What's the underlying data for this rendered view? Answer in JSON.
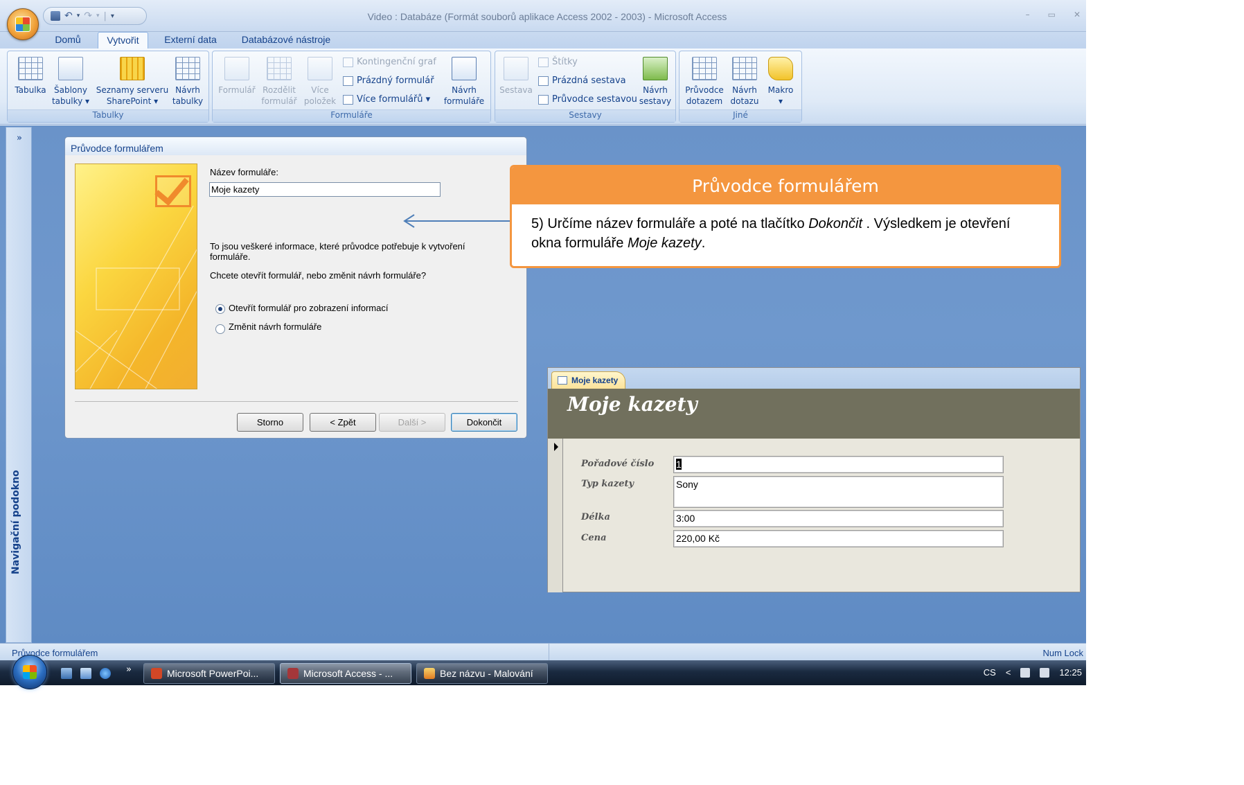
{
  "window": {
    "title": "Video : Databáze (Formát souborů aplikace Access 2002 - 2003) - Microsoft Access",
    "controls": [
      "–",
      "▭",
      "✕"
    ]
  },
  "qat": {
    "separator": "|",
    "dropdown": "▾"
  },
  "tabs": [
    {
      "label": "Domů",
      "active": false
    },
    {
      "label": "Vytvořit",
      "active": true
    },
    {
      "label": "Externí data",
      "active": false
    },
    {
      "label": "Databázové nástroje",
      "active": false
    }
  ],
  "ribbon": {
    "tabulky": {
      "label": "Tabulky",
      "buttons": [
        {
          "line1": "Tabulka",
          "line2": ""
        },
        {
          "line1": "Šablony",
          "line2": "tabulky ▾"
        },
        {
          "line1": "Seznamy serveru",
          "line2": "SharePoint ▾"
        },
        {
          "line1": "Návrh",
          "line2": "tabulky"
        }
      ]
    },
    "formulare": {
      "label": "Formuláře",
      "buttons": [
        {
          "line1": "Formulář",
          "line2": ""
        },
        {
          "line1": "Rozdělit",
          "line2": "formulář"
        },
        {
          "line1": "Více",
          "line2": "položek"
        },
        {
          "line1": "Návrh",
          "line2": "formuláře"
        }
      ],
      "small": [
        "Kontingenční graf",
        "Prázdný formulář",
        "Více formulářů ▾"
      ]
    },
    "sestavy": {
      "label": "Sestavy",
      "buttons": [
        {
          "line1": "Sestava",
          "line2": ""
        },
        {
          "line1": "Návrh",
          "line2": "sestavy"
        }
      ],
      "small": [
        "Štítky",
        "Prázdná sestava",
        "Průvodce sestavou"
      ]
    },
    "jine": {
      "label": "Jiné",
      "buttons": [
        {
          "line1": "Průvodce",
          "line2": "dotazem"
        },
        {
          "line1": "Návrh",
          "line2": "dotazu"
        },
        {
          "line1": "Makro",
          "line2": "▾"
        }
      ]
    }
  },
  "navpane": {
    "toggle": "»",
    "label": "Navigační podokno"
  },
  "wizard": {
    "title": "Průvodce formulářem",
    "name_label": "Název formuláře:",
    "name_value": "Moje kazety",
    "info_line1": "To jsou veškeré informace, které průvodce potřebuje k vytvoření",
    "info_line2": "formuláře.",
    "question": "Chcete otevřít formulář, nebo změnit návrh formuláře?",
    "options": [
      {
        "label": "Otevřít formulář pro zobrazení informací",
        "selected": true
      },
      {
        "label": "Změnit návrh formuláře",
        "selected": false
      }
    ],
    "buttons": {
      "cancel": "Storno",
      "back": "< Zpět",
      "next": "Další >",
      "finish": "Dokončit"
    }
  },
  "callout": {
    "title": "Průvodce formulářem",
    "text_part1": "5) Určíme název formuláře a poté na tlačítko ",
    "text_em1": "Dokončit",
    "text_part2": " . Výsledkem je otevření okna formuláře ",
    "text_em2": "Moje kazety",
    "text_part3": "."
  },
  "form": {
    "tab_label": "Moje kazety",
    "heading": "Moje kazety",
    "fields": [
      {
        "label": "Pořadové číslo",
        "value": "1"
      },
      {
        "label": "Typ kazety",
        "value": "Sony"
      },
      {
        "label": "Délka",
        "value": "3:00"
      },
      {
        "label": "Cena",
        "value": "220,00 Kč"
      }
    ]
  },
  "statusbar": {
    "left": "Průvodce formulářem",
    "right": "Num Lock"
  },
  "taskbar": {
    "chevron": "»",
    "tasks": [
      {
        "label": "Microsoft PowerPoi...",
        "active": false
      },
      {
        "label": "Microsoft Access - ...",
        "active": true
      },
      {
        "label": "Bez názvu - Malování",
        "active": false
      }
    ],
    "tray": {
      "lang": "CS",
      "arrow": "<",
      "clock": "12:25"
    }
  },
  "colors": {
    "accent_orange": "#f4963f",
    "form_header": "#71705d",
    "workspace_blue": "#6a93c9"
  }
}
